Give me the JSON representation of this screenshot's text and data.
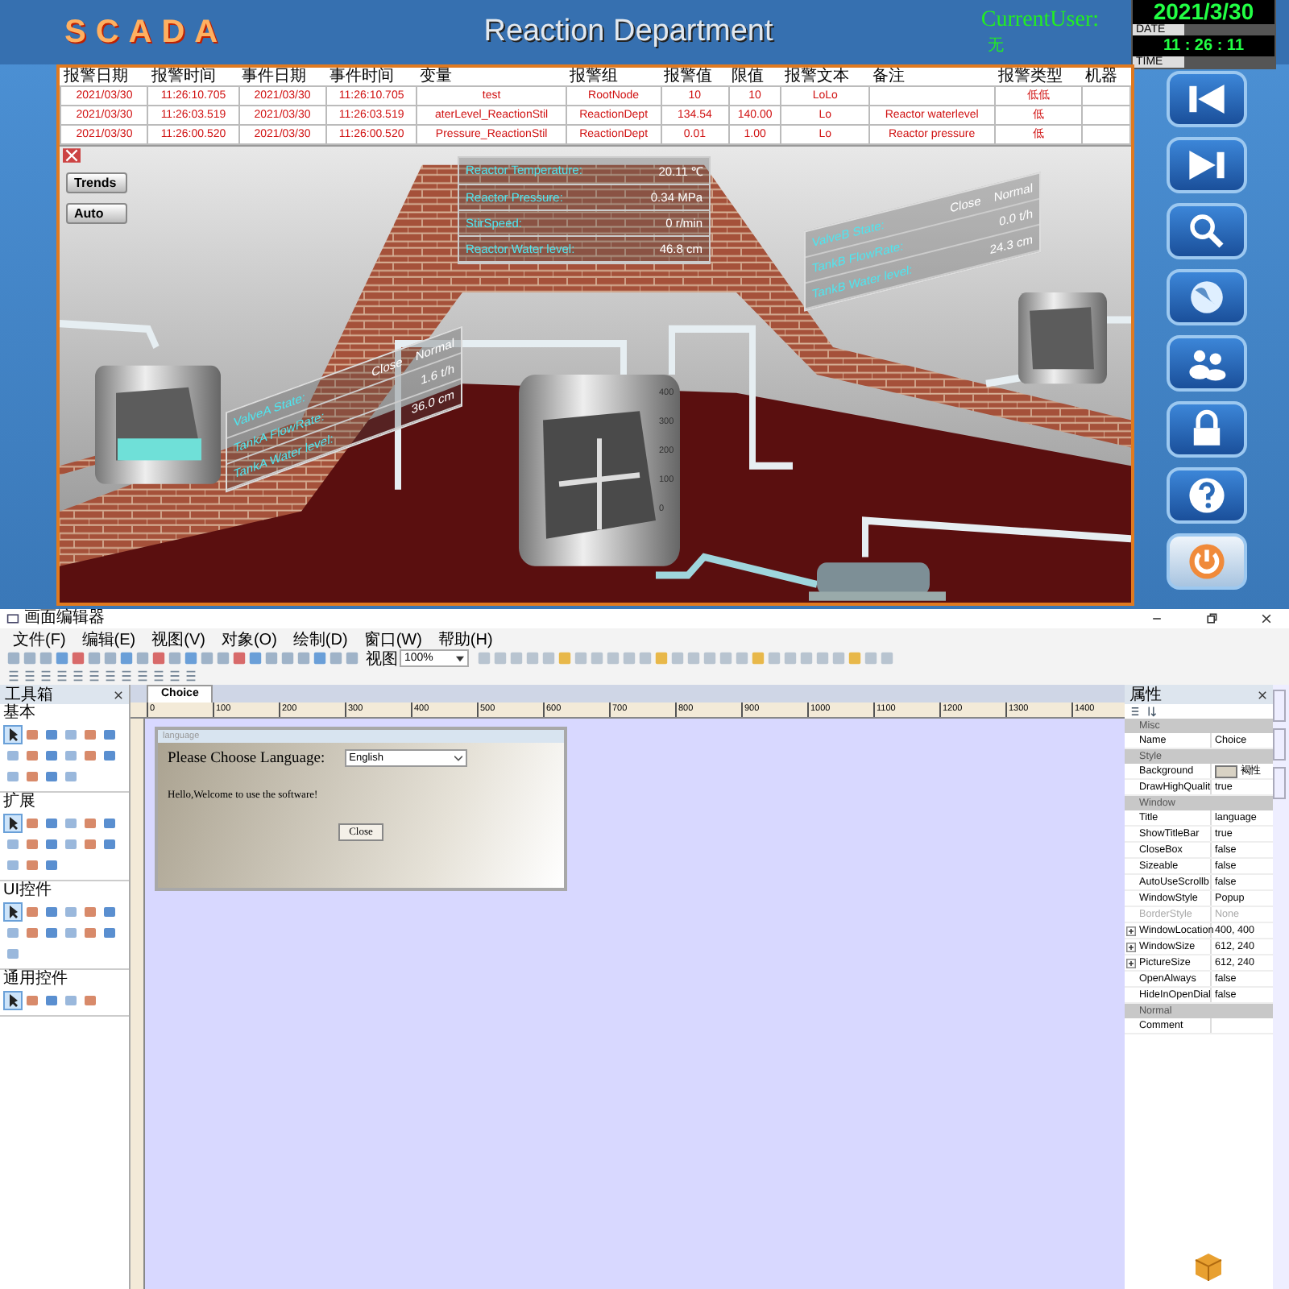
{
  "header": {
    "logo": "SCADA",
    "title": "Reaction Department",
    "user_label": "CurrentUser:",
    "user_value": "无",
    "date": "2021/3/30",
    "date_label": "DATE",
    "time": "11 : 26 : 11",
    "time_label": "TIME"
  },
  "alarm_table": {
    "columns": [
      "报警日期",
      "报警时间",
      "事件日期",
      "事件时间",
      "变量",
      "报警组",
      "报警值",
      "限值",
      "报警文本",
      "备注",
      "报警类型",
      "机器"
    ],
    "rows": [
      [
        "2021/03/30",
        "11:26:10.705",
        "2021/03/30",
        "11:26:10.705",
        "test",
        "RootNode",
        "10",
        "10",
        "LoLo",
        "",
        "低低",
        ""
      ],
      [
        "2021/03/30",
        "11:26:03.519",
        "2021/03/30",
        "11:26:03.519",
        "aterLevel_ReactionStil",
        "ReactionDept",
        "134.54",
        "140.00",
        "Lo",
        "Reactor waterlevel",
        "低",
        ""
      ],
      [
        "2021/03/30",
        "11:26:00.520",
        "2021/03/30",
        "11:26:00.520",
        "Pressure_ReactionStil",
        "ReactionDept",
        "0.01",
        "1.00",
        "Lo",
        "Reactor pressure",
        "低",
        ""
      ]
    ]
  },
  "side_buttons": [
    "Trends",
    "Auto"
  ],
  "reactor_panel": [
    {
      "label": "Reactor Temperature:",
      "value": "20.11 ℃"
    },
    {
      "label": "Reactor Pressure:",
      "value": "0.34 MPa"
    },
    {
      "label": "StirSpeed:",
      "value": "0 r/min"
    },
    {
      "label": "Reactor Water level:",
      "value": "46.8 cm"
    }
  ],
  "tank_a_panel": [
    {
      "label": "ValveA State:",
      "values": [
        "Close",
        "Normal"
      ]
    },
    {
      "label": "TankA FlowRate:",
      "values": [
        "1.6 t/h"
      ]
    },
    {
      "label": "TankA Water level:",
      "values": [
        "36.0 cm"
      ]
    }
  ],
  "tank_b_panel": [
    {
      "label": "ValveB State:",
      "values": [
        "Close",
        "Normal"
      ]
    },
    {
      "label": "TankB FlowRate:",
      "values": [
        "0.0 t/h"
      ]
    },
    {
      "label": "TankB Water level:",
      "values": [
        "24.3 cm"
      ]
    }
  ],
  "reactor_scale": [
    "400",
    "300",
    "200",
    "100",
    "0"
  ],
  "nav_buttons": [
    {
      "kind": "first"
    },
    {
      "kind": "next"
    },
    {
      "kind": "search"
    },
    {
      "kind": "globe"
    },
    {
      "kind": "users"
    },
    {
      "kind": "lock"
    },
    {
      "kind": "help"
    },
    {
      "kind": "power"
    }
  ],
  "editor": {
    "title": "画面编辑器",
    "menu": [
      "文件(F)",
      "编辑(E)",
      "视图(V)",
      "对象(O)",
      "绘制(D)",
      "窗口(W)",
      "帮助(H)"
    ],
    "zoom_label": "视图",
    "zoom": "100%",
    "toolbox": {
      "title": "工具箱",
      "sections": [
        "基本",
        "扩展",
        "UI控件",
        "通用控件"
      ]
    },
    "document_tab": "Choice",
    "ruler": [
      "0",
      "100",
      "200",
      "300",
      "400",
      "500",
      "600",
      "700",
      "800",
      "900",
      "1000",
      "1100",
      "1200",
      "1300",
      "1400"
    ],
    "dialog": {
      "title": "language",
      "prompt": "Please Choose Language:",
      "language": "English",
      "message": "Hello,Welcome to use the software!",
      "button": "Close"
    },
    "properties": {
      "title": "属性",
      "groups": [
        {
          "name": "Misc",
          "rows": [
            {
              "kind": "text",
              "name": "Name",
              "value": "Choice",
              "disabled": false,
              "expandable": false
            }
          ]
        },
        {
          "name": "Style",
          "rows": [
            {
              "kind": "color",
              "name": "Background",
              "value": "褐性",
              "disabled": false,
              "expandable": false
            },
            {
              "kind": "text",
              "name": "DrawHighQualit",
              "value": "true",
              "disabled": false,
              "expandable": false
            }
          ]
        },
        {
          "name": "Window",
          "rows": [
            {
              "kind": "text",
              "name": "Title",
              "value": "language",
              "disabled": false,
              "expandable": false
            },
            {
              "kind": "text",
              "name": "ShowTitleBar",
              "value": "true",
              "disabled": false,
              "expandable": false
            },
            {
              "kind": "text",
              "name": "CloseBox",
              "value": "false",
              "disabled": false,
              "expandable": false
            },
            {
              "kind": "text",
              "name": "Sizeable",
              "value": "false",
              "disabled": false,
              "expandable": false
            },
            {
              "kind": "text",
              "name": "AutoUseScrollb",
              "value": "false",
              "disabled": false,
              "expandable": false
            },
            {
              "kind": "text",
              "name": "WindowStyle",
              "value": "Popup",
              "disabled": false,
              "expandable": false
            },
            {
              "kind": "text",
              "name": "BorderStyle",
              "value": "None",
              "disabled": true,
              "expandable": false
            },
            {
              "kind": "text",
              "name": "WindowLocation",
              "value": "400, 400",
              "disabled": false,
              "expandable": true
            },
            {
              "kind": "text",
              "name": "WindowSize",
              "value": "612, 240",
              "disabled": false,
              "expandable": true
            },
            {
              "kind": "text",
              "name": "PictureSize",
              "value": "612, 240",
              "disabled": false,
              "expandable": true
            },
            {
              "kind": "text",
              "name": "OpenAlways",
              "value": "false",
              "disabled": false,
              "expandable": false
            },
            {
              "kind": "text",
              "name": "HideInOpenDial",
              "value": "false",
              "disabled": false,
              "expandable": false
            }
          ]
        },
        {
          "name": "Normal",
          "rows": [
            {
              "kind": "text",
              "name": "Comment",
              "value": "",
              "disabled": false,
              "expandable": false
            }
          ]
        }
      ]
    }
  }
}
